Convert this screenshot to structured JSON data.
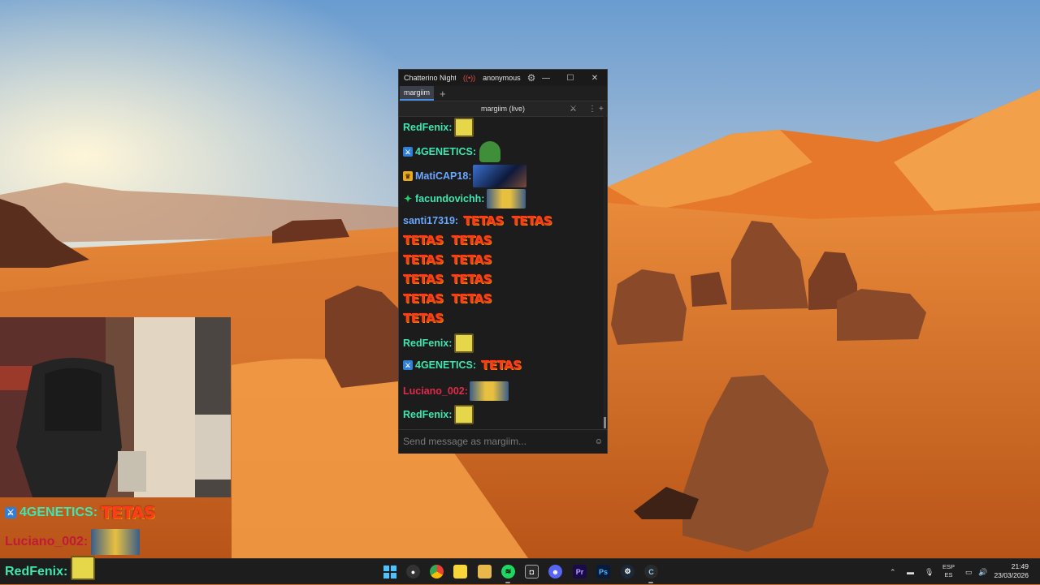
{
  "window": {
    "title": "Chatterino Nightly",
    "account": "anonymous",
    "tab": "margiim",
    "channel_header": "margiim (live)",
    "input_placeholder": "Send message as margiim..."
  },
  "messages": [
    {
      "user": "RedFenix:",
      "color": "#3ee6b0",
      "badge": "",
      "emote": "sponge"
    },
    {
      "user": "4GENETICS:",
      "color": "#3ee6b0",
      "badge": "mod",
      "emote": "pepe"
    },
    {
      "user": "MatiCAP18:",
      "color": "#6aa7ff",
      "badge": "crown",
      "emote": "anime"
    },
    {
      "user": "facundovichh:",
      "color": "#3ee6b0",
      "badge": "gem",
      "emote": "minions"
    },
    {
      "user": "santi17319:",
      "color": "#6aa7ff",
      "badge": "",
      "emote": "tetas-many"
    },
    {
      "user": "RedFenix:",
      "color": "#3ee6b0",
      "badge": "",
      "emote": "sponge"
    },
    {
      "user": "4GENETICS:",
      "color": "#3ee6b0",
      "badge": "mod",
      "emote": "tetas"
    },
    {
      "user": "Luciano_002:",
      "color": "#e02a4a",
      "badge": "",
      "emote": "minions"
    },
    {
      "user": "RedFenix:",
      "color": "#3ee6b0",
      "badge": "",
      "emote": "sponge"
    }
  ],
  "emote_text": "TETAS",
  "overlay": [
    {
      "user": "4GENETICS:",
      "color": "#3ee6b0",
      "badge": "mod",
      "emote": "tetas"
    },
    {
      "user": "Luciano_002:",
      "color": "#e02a4a",
      "emote": "minions"
    },
    {
      "user": "RedFenix:",
      "color": "#3ee6b0",
      "emote": "sponge"
    }
  ],
  "taskbar": {
    "apps": [
      "windows-start",
      "obs",
      "chrome",
      "sticky-notes",
      "file-explorer",
      "spotify",
      "capture",
      "discord",
      "premiere-pro",
      "photoshop",
      "steam",
      "chatterino"
    ],
    "premiere_label": "Pr",
    "photoshop_label": "Ps",
    "lang_top": "ESP",
    "lang_bottom": "ES",
    "time": "21:49",
    "date": "23/03/2026"
  },
  "colors": {
    "chat_bg": "#1c1c1c",
    "accent": "#4a90e2",
    "sky_top": "#6a9cd0",
    "sand": "#e07a2c"
  }
}
